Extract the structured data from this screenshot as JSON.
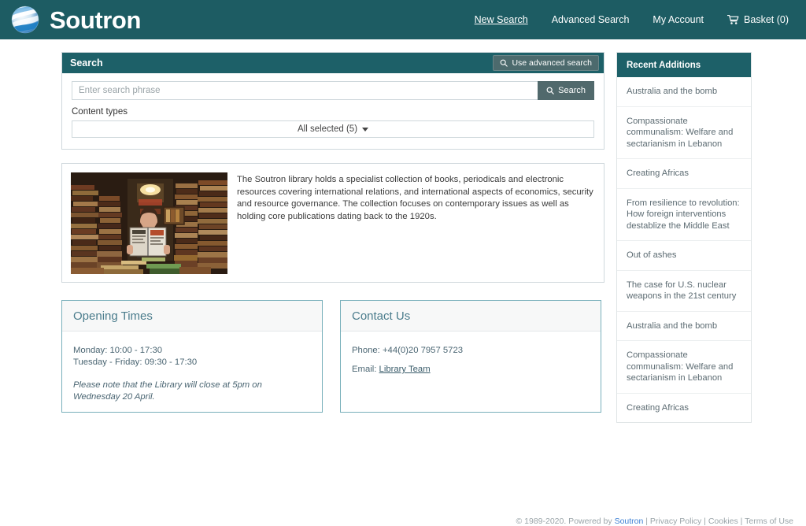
{
  "header": {
    "brand_name": "Soutron",
    "logo_icon": "globe-swirl-logo",
    "nav": [
      {
        "label": "New Search",
        "active": true
      },
      {
        "label": "Advanced Search",
        "active": false
      },
      {
        "label": "My Account",
        "active": false
      }
    ],
    "basket_label": "Basket (0)",
    "basket_icon": "shopping-cart-icon"
  },
  "search": {
    "panel_title": "Search",
    "advanced_button_label": "Use advanced search",
    "advanced_button_icon": "search-icon",
    "input_placeholder": "Enter search phrase",
    "input_value": "",
    "search_button_label": "Search",
    "search_button_icon": "search-icon",
    "content_types_label": "Content types",
    "content_types_value": "All selected (5)"
  },
  "about": {
    "image_alt": "library-books-photo",
    "text": "The Soutron library holds a specialist collection of books, periodicals and electronic resources covering international relations, and international aspects of economics, security and resource governance. The collection focuses on contemporary issues as well as holding core publications dating back to the 1920s."
  },
  "opening_times": {
    "title": "Opening Times",
    "line1": "Monday: 10:00 - 17:30",
    "line2": "Tuesday - Friday: 09:30 - 17:30",
    "note": "Please note that the Library will close at 5pm on Wednesday 20 April."
  },
  "contact": {
    "title": "Contact Us",
    "phone_label": "Phone: +44(0)20 7957 5723",
    "email_prefix": "Email: ",
    "email_link_label": "Library Team"
  },
  "sidebar": {
    "title": "Recent Additions",
    "items": [
      {
        "label": "Australia and the bomb"
      },
      {
        "label": "Compassionate communalism: Welfare and sectarianism in Lebanon"
      },
      {
        "label": "Creating Africas"
      },
      {
        "label": "From resilience to revolution: How foreign interventions destablize the Middle East"
      },
      {
        "label": "Out of ashes"
      },
      {
        "label": "The case for U.S. nuclear weapons in the 21st century"
      },
      {
        "label": "Australia and the bomb"
      },
      {
        "label": "Compassionate communalism: Welfare and sectarianism in Lebanon"
      },
      {
        "label": "Creating Africas"
      }
    ]
  },
  "footer": {
    "copyright": "© 1989-2020. Powered by ",
    "brand_link": "Soutron",
    "sep1": " | ",
    "privacy": "Privacy Policy",
    "sep2": " | ",
    "cookies": "Cookies",
    "sep3": " | ",
    "terms": "Terms of Use"
  },
  "colors": {
    "header_teal": "#1d5c63",
    "panel_teal": "#1d6068",
    "button_slate": "#51696c",
    "card_border": "#79b0bb",
    "card_title": "#4a7c8c",
    "link_blue": "#3b7fd4"
  }
}
